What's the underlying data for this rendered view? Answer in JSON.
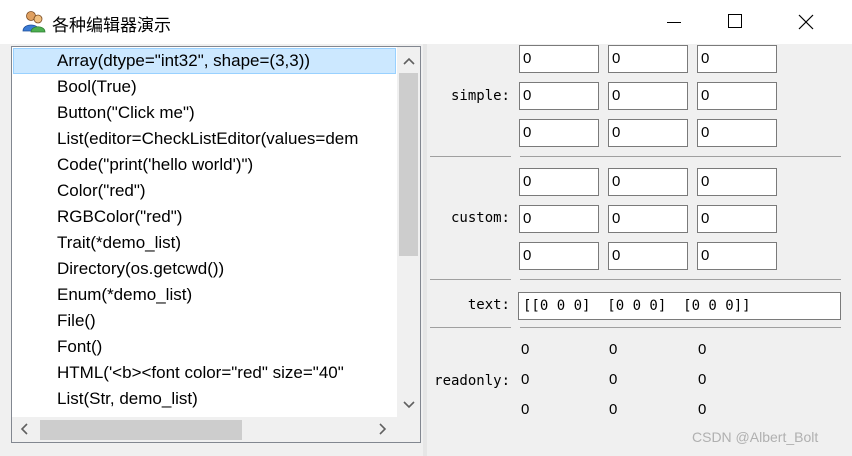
{
  "window": {
    "title": "各种编辑器演示",
    "icon": "users-icon",
    "controls": [
      "minimize-icon",
      "maximize-icon",
      "close-icon"
    ]
  },
  "list": {
    "items": [
      "Array(dtype=\"int32\", shape=(3,3))",
      "Bool(True)",
      "Button(\"Click me\")",
      "List(editor=CheckListEditor(values=dem",
      "Code(\"print('hello world')\")",
      "Color(\"red\")",
      "RGBColor(\"red\")",
      "Trait(*demo_list)",
      "Directory(os.getcwd())",
      "Enum(*demo_list)",
      "File()",
      "Font()",
      "HTML('<b><font color=\"red\" size=\"40\"",
      "List(Str, demo_list)"
    ],
    "selected_index": 0
  },
  "editor": {
    "simple_label": "simple:",
    "custom_label": "custom:",
    "text_label": "text:",
    "readonly_label": "readonly:",
    "simple_values": [
      [
        "0",
        "0",
        "0"
      ],
      [
        "0",
        "0",
        "0"
      ],
      [
        "0",
        "0",
        "0"
      ]
    ],
    "custom_values": [
      [
        "0",
        "0",
        "0"
      ],
      [
        "0",
        "0",
        "0"
      ],
      [
        "0",
        "0",
        "0"
      ]
    ],
    "text_value": "[[0 0 0]  [0 0 0]  [0 0 0]]",
    "readonly_values": [
      [
        "0",
        "0",
        "0"
      ],
      [
        "0",
        "0",
        "0"
      ],
      [
        "0",
        "0",
        "0"
      ]
    ]
  },
  "watermark": "CSDN @Albert_Bolt",
  "colors": {
    "selection_bg": "#cce8ff",
    "selection_border": "#99d1ff",
    "window_bg": "#f0f0f0"
  }
}
